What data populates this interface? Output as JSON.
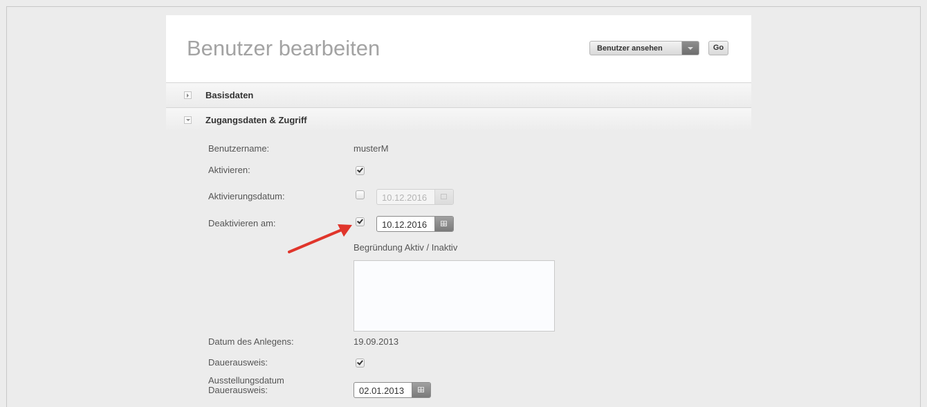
{
  "header": {
    "title": "Benutzer bearbeiten",
    "view_select": "Benutzer ansehen",
    "go_label": "Go"
  },
  "sections": [
    {
      "label": "Basisdaten",
      "expanded": false
    },
    {
      "label": "Zugangsdaten & Zugriff",
      "expanded": true
    }
  ],
  "form": {
    "username_label": "Benutzername:",
    "username_value": "musterM",
    "activate_label": "Aktivieren:",
    "activate_checked": true,
    "activation_date_label": "Aktivierungsdatum:",
    "activation_date_checked": false,
    "activation_date_value": "10.12.2016",
    "deactivate_label": "Deaktivieren am:",
    "deactivate_checked": true,
    "deactivate_value": "10.12.2016",
    "reason_label": "Begründung Aktiv / Inaktiv",
    "reason_value": "",
    "created_label": "Datum des Anlegens:",
    "created_value": "19.09.2013",
    "permanent_pass_label": "Dauerausweis:",
    "permanent_pass_checked": true,
    "issue_date_label_line1": "Ausstellungsdatum",
    "issue_date_label_line2": "Dauerausweis:",
    "issue_date_value": "02.01.2013"
  },
  "annotation": {
    "arrow_color": "#e0352b"
  },
  "icons": [
    "triangle-right-icon",
    "triangle-down-icon",
    "calendar-icon",
    "checkmark-icon",
    "red-arrow-icon"
  ]
}
